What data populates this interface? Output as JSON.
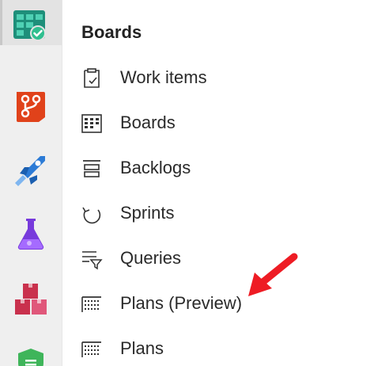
{
  "rail": {
    "items": [
      {
        "icon": "boards-icon",
        "active": true
      },
      {
        "icon": "repos-icon",
        "active": false
      },
      {
        "icon": "pipelines-icon",
        "active": false
      },
      {
        "icon": "test-plans-icon",
        "active": false
      },
      {
        "icon": "artifacts-icon",
        "active": false
      },
      {
        "icon": "security-icon",
        "active": false
      }
    ]
  },
  "flyout": {
    "title": "Boards",
    "items": [
      {
        "label": "Work items",
        "icon": "work-items-icon"
      },
      {
        "label": "Boards",
        "icon": "boards-grid-icon"
      },
      {
        "label": "Backlogs",
        "icon": "backlogs-icon"
      },
      {
        "label": "Sprints",
        "icon": "sprints-icon"
      },
      {
        "label": "Queries",
        "icon": "queries-icon"
      },
      {
        "label": "Plans (Preview)",
        "icon": "plans-icon"
      },
      {
        "label": "Plans",
        "icon": "plans-icon"
      }
    ]
  },
  "colors": {
    "boards": "#009ccc",
    "repos": "#e0421a",
    "pipelines": "#2c7bd6",
    "test_plans": "#773adc",
    "artifacts": "#c9314d",
    "security": "#3fb55a",
    "annotation_arrow": "#ee1c24"
  }
}
